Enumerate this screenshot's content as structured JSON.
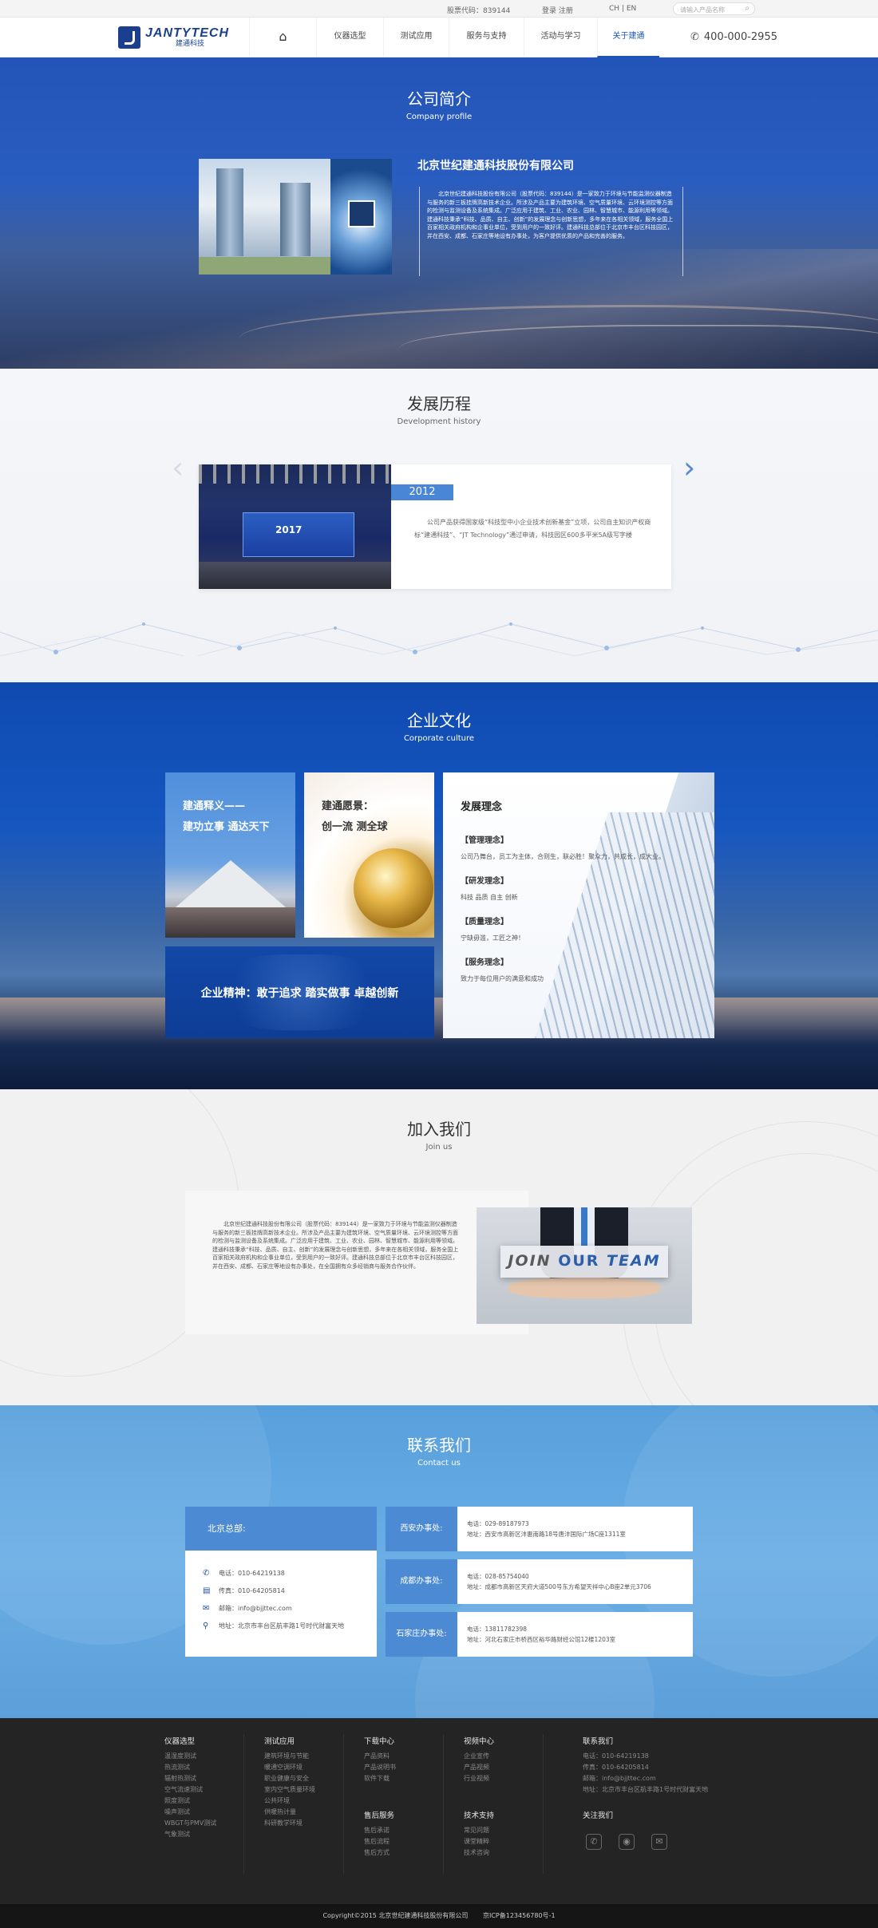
{
  "topbar": {
    "stock": "股票代码：839144",
    "login": "登录",
    "register": "注册",
    "lang_cn": "CH",
    "lang_sep": "|",
    "lang_en": "EN",
    "search_placeholder": "请输入产品名称"
  },
  "brand": {
    "en": "JANTYTECH",
    "cn": "建通科技"
  },
  "nav": {
    "items": [
      {
        "label": "仪器选型"
      },
      {
        "label": "测试应用"
      },
      {
        "label": "服务与支持"
      },
      {
        "label": "活动与学习"
      },
      {
        "label": "关于建通"
      }
    ],
    "phone": "400-000-2955"
  },
  "profile": {
    "title_cn": "公司简介",
    "title_en": "Company profile",
    "company": "北京世纪建通科技股份有限公司",
    "intro": "北京世纪建通科技股份有限公司（股票代码：839144）是一家致力于环境与节能监测仪器制造与服务的新三板挂牌高新技术企业。所涉及产品主要为建筑环境、空气质量环境、云环境测控等方面的检测与监测设备及系统集成。广泛应用于建筑、工业、农业、园林、智慧城市、能源利用等领域。建通科技秉承“科技、品质、自主、创新”的发展理念与创新思想，多年来在各相关领域，服务全国上百家相关政府机构和企事业单位，受到用户的一致好评。建通科技总部位于北京市丰台区科技园区，并在西安、成都、石家庄等地设有办事处，为客户提供优质的产品和完善的服务。"
  },
  "history": {
    "title_cn": "发展历程",
    "title_en": "Development history",
    "year": "2012",
    "desc": "公司产品获得国家级“科技型中小企业技术创新基金”立项，公司自主知识产权商标“建通科技”、“JT Technology”通过申请，科技园区600多平米5A级写字楼",
    "photo_banner": "2017"
  },
  "culture": {
    "title_cn": "企业文化",
    "title_en": "Corporate culture",
    "box1_line1": "建通释义——",
    "box1_line2": "建功立事 通达天下",
    "box2_line1": "建通愿景：",
    "box2_line2": "创一流 测全球",
    "spirit": "企业精神：敢于追求 踏实做事 卓越创新",
    "dev_title": "发展理念",
    "items": [
      {
        "title": "【管理理念】",
        "desc": "公司乃舞台，员工为主体，合则生，联必胜！聚众力，共成长，成大业。"
      },
      {
        "title": "【研发理念】",
        "desc": "科技 品质 自主 创新"
      },
      {
        "title": "【质量理念】",
        "desc": "宁缺毋滥，工匠之神！"
      },
      {
        "title": "【服务理念】",
        "desc": "致力于每位用户的满意和成功"
      }
    ]
  },
  "join": {
    "title_cn": "加入我们",
    "title_en": "Join us",
    "text": "北京世纪建通科技股份有限公司（股票代码：839144）是一家致力于环境与节能监测仪器制造与服务的新三板挂牌高新技术企业。所涉及产品主要为建筑环境、空气质量环境、云环境测控等方面的检测与监测设备及系统集成。广泛应用于建筑、工业、农业、园林、智慧城市、能源利用等领域。建通科技秉承“科技、品质、自主、创新”的发展理念与创新思想，多年来在各相关领域，服务全国上百家相关政府机构和企事业单位，受到用户的一致好评。建通科技总部位于北京市丰台区科技园区，并在西安、成都、石家庄等地设有办事处，在全国拥有众多经销商与服务合作伙伴。",
    "img_word1": "JOIN",
    "img_word2": "OUR",
    "img_word3": "TEAM"
  },
  "contact": {
    "title_cn": "联系我们",
    "title_en": "Contact us",
    "hq_title": "北京总部:",
    "hq_rows": [
      "电话：010-64219138",
      "传真：010-64205814",
      "邮箱：info@bjjttec.com",
      "地址：北京市丰台区航丰路1号时代财富天地"
    ],
    "offices": [
      {
        "label": "西安办事处:",
        "phone": "电话：029-89187973",
        "addr": "地址：西安市高新区沣惠南路18号唐沣国际广场C座1311室"
      },
      {
        "label": "成都办事处:",
        "phone": "电话：028-85754040",
        "addr": "地址：成都市高新区天府大道500号东方希望天祥中心B座2单元3706"
      },
      {
        "label": "石家庄办事处:",
        "phone": "电话：13811782398",
        "addr": "地址：河北石家庄市桥西区裕华路财经公馆12楼1203室"
      }
    ]
  },
  "footer": {
    "cols": [
      {
        "title": "仪器选型",
        "links": [
          "温湿度测试",
          "热流测试",
          "辐射热测试",
          "空气流速测试",
          "照度测试",
          "噪声测试",
          "WBGT与PMV测试",
          "气象测试"
        ]
      },
      {
        "title": "测试应用",
        "links": [
          "建筑环境与节能",
          "暖通空调环境",
          "职业健康与安全",
          "室内空气质量环境",
          "公共环境",
          "供暖热计量",
          "科研教学环境"
        ]
      },
      {
        "title": "下载中心",
        "links": [
          "产品资料",
          "产品说明书",
          "软件下载"
        ]
      },
      {
        "title": "视频中心",
        "links": [
          "企业宣传",
          "产品视频",
          "行业视频"
        ]
      }
    ],
    "cols2": [
      {
        "title": "售后服务",
        "links": [
          "售后承诺",
          "售后流程",
          "售后方式"
        ]
      },
      {
        "title": "技术支持",
        "links": [
          "常见问题",
          "课堂精粹",
          "技术咨询"
        ]
      }
    ],
    "contact_title": "联系我们",
    "contact_lines": [
      "电话：010-64219138",
      "传真：010-64205814",
      "邮箱：info@bjjttec.com",
      "地址：北京市丰台区航丰路1号时代财富天地"
    ],
    "follow_title": "关注我们",
    "copyright": "Copyright©2015  北京世纪建通科技股份有限公司",
    "icp": "京ICP备123456780号-1"
  }
}
